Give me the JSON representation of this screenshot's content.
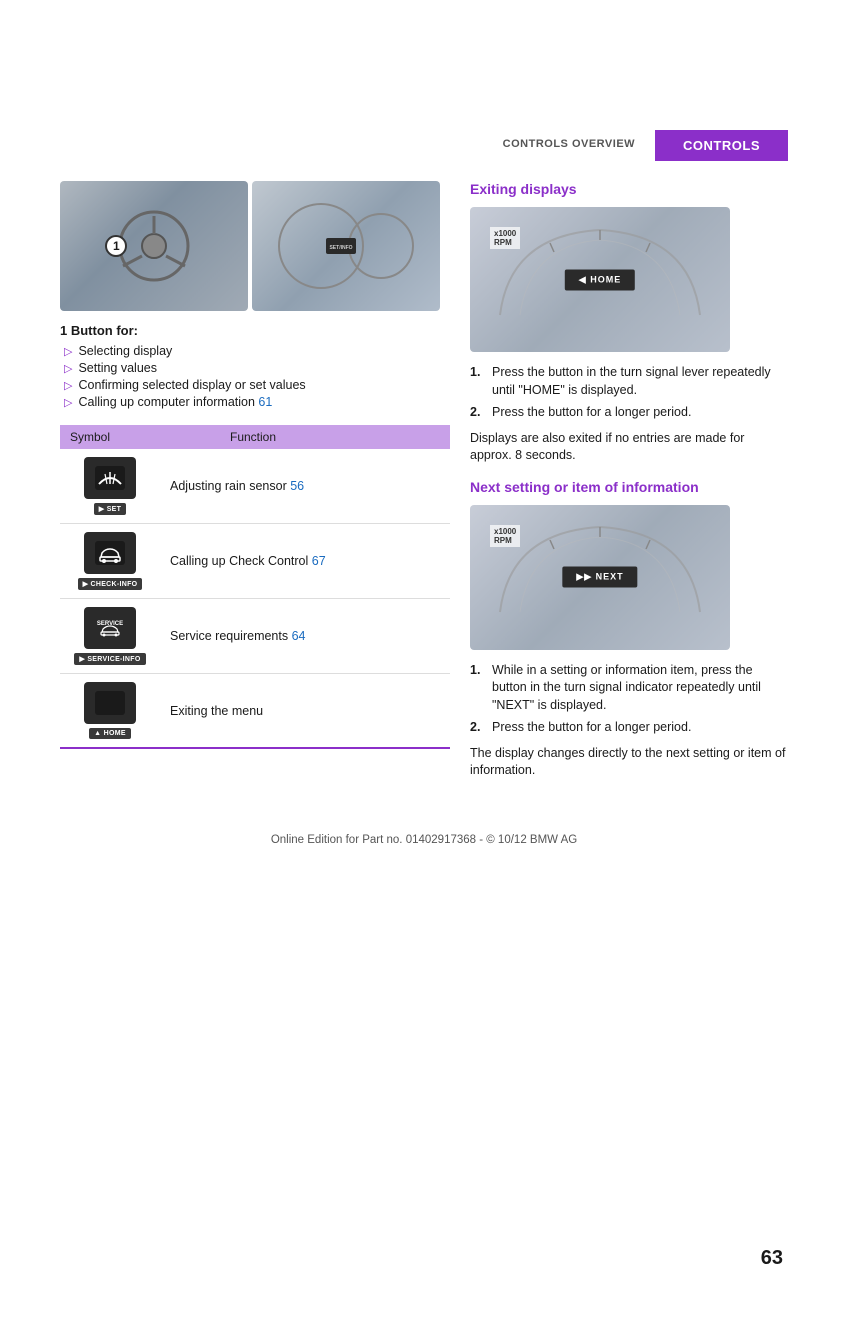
{
  "header": {
    "tab_left": "CONTROLS OVERVIEW",
    "tab_right": "CONTROLS"
  },
  "left": {
    "button_title": "1   Button for:",
    "button_items": [
      {
        "text": "Selecting display"
      },
      {
        "text": "Setting values"
      },
      {
        "text": "Confirming selected display or set values"
      },
      {
        "text": "Calling up computer information",
        "link": "61"
      }
    ],
    "table_header": {
      "col1": "Symbol",
      "col2": "Function"
    },
    "table_rows": [
      {
        "icon_type": "wiper",
        "btn_label": "▶ SET",
        "function": "Adjusting rain sensor",
        "link": "56"
      },
      {
        "icon_type": "car",
        "btn_label": "▶ CHECK-INFO",
        "function": "Calling up Check Control",
        "link": "67"
      },
      {
        "icon_type": "service",
        "btn_label": "▶ SERVICE-INFO",
        "function": "Service requirements",
        "link": "64"
      },
      {
        "icon_type": "home",
        "btn_label": "▲ HOME",
        "function": "Exiting the menu",
        "link": null
      }
    ]
  },
  "right": {
    "section1": {
      "title": "Exiting displays",
      "steps": [
        "Press the button in the turn signal lever repeatedly until \"HOME\" is displayed.",
        "Press the button for a longer period."
      ],
      "note": "Displays are also exited if no entries are made for approx. 8 seconds.",
      "gauge_label": "◀ HOME"
    },
    "section2": {
      "title": "Next setting or item of information",
      "steps": [
        "While in a setting or information item, press the button in the turn signal indicator repeatedly until \"NEXT\" is displayed.",
        "Press the button for a longer period."
      ],
      "note": "The display changes directly to the next setting or item of information.",
      "gauge_label": "▶▶ NEXT"
    }
  },
  "footer": {
    "copyright": "Online Edition for Part no. 01402917368 - © 10/12 BMW AG",
    "page_number": "63"
  }
}
